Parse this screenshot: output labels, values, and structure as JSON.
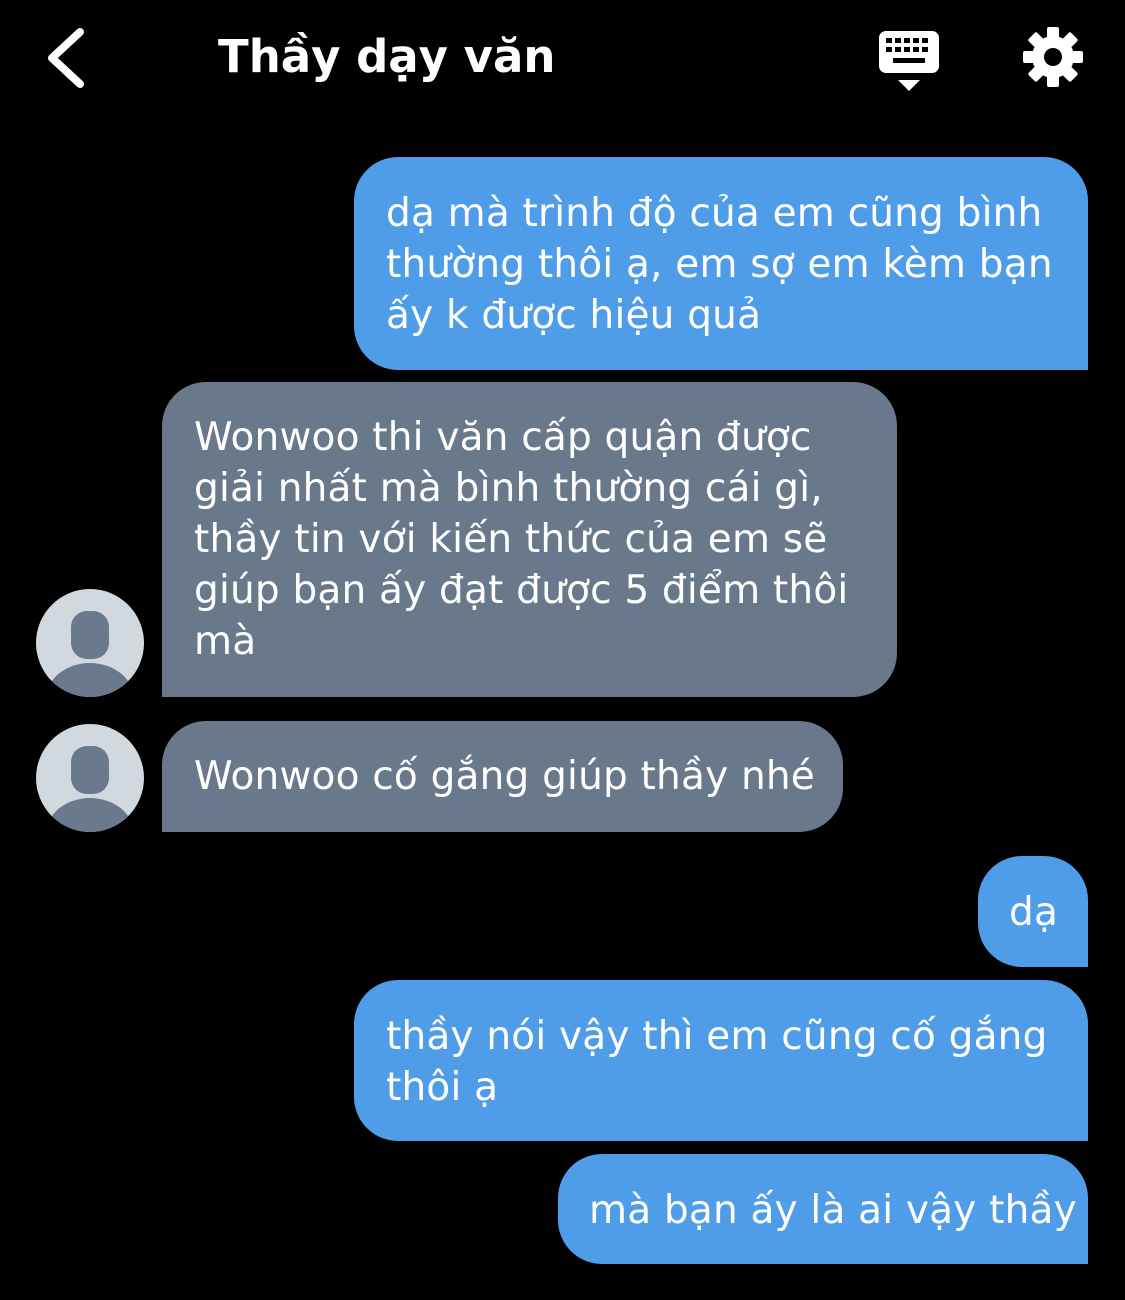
{
  "header": {
    "title": "Thầy dạy văn",
    "back_icon": "chevron-left-icon",
    "keyboard_icon": "keyboard-icon",
    "settings_icon": "gear-icon"
  },
  "messages": [
    {
      "direction": "outgoing",
      "text": "dạ mà trình độ của em cũng bình\nthường thôi ạ, em sợ em kèm bạn\nấy k được hiệu quả"
    },
    {
      "direction": "incoming",
      "text": "Wonwoo thi văn cấp quận được\ngiải nhất mà bình thường cái gì,\nthầy tin với kiến thức của em sẽ\ngiúp bạn ấy đạt được 5 điểm thôi\nmà"
    },
    {
      "direction": "incoming",
      "text": "Wonwoo cố gắng giúp thầy nhé"
    },
    {
      "direction": "outgoing",
      "text": "dạ"
    },
    {
      "direction": "outgoing",
      "text": "thầy nói vậy thì em cũng cố gắng\nthôi ạ"
    },
    {
      "direction": "outgoing",
      "text": "mà bạn ấy là ai vậy thầy"
    }
  ],
  "colors": {
    "background": "#000000",
    "outgoing_bubble": "#4f9de8",
    "incoming_bubble": "#69788a",
    "avatar_bg": "#d2d9de",
    "avatar_fg": "#6a7a8c"
  }
}
